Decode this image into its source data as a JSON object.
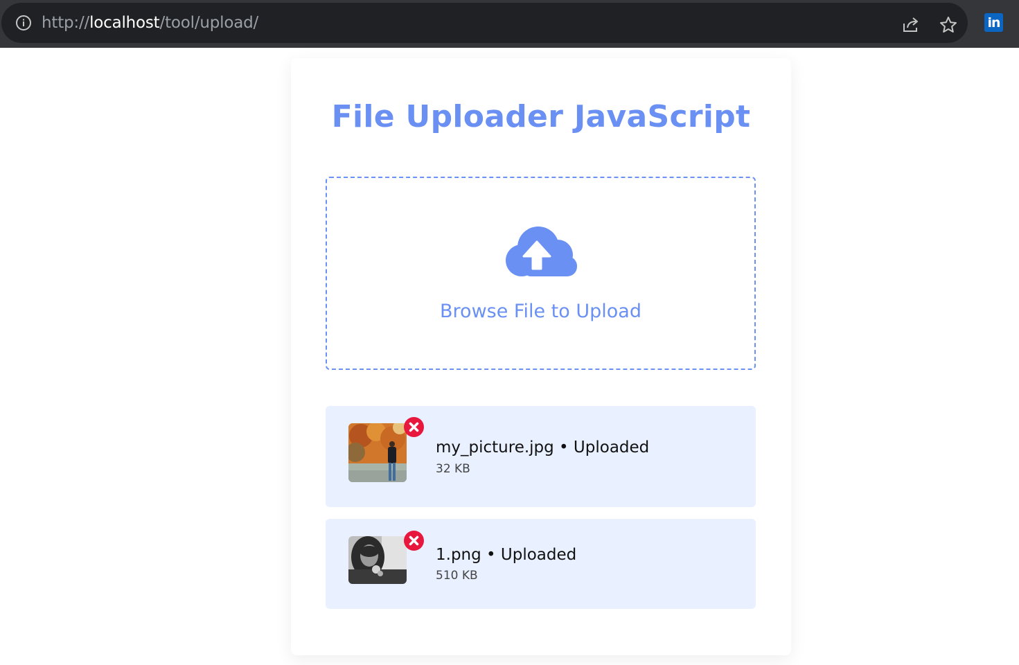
{
  "browser": {
    "url_scheme": "http://",
    "url_host": "localhost",
    "url_path": "/tool/upload/",
    "icons": [
      "info-icon",
      "share-icon",
      "star-icon",
      "linkedin-icon"
    ],
    "extension_label": "in"
  },
  "page": {
    "title": "File Uploader JavaScript",
    "accent_color": "#6990f2"
  },
  "dropzone": {
    "label": "Browse File to Upload",
    "icon": "cloud-upload-icon"
  },
  "files": [
    {
      "name": "my_picture.jpg",
      "status": "Uploaded",
      "display": "my_picture.jpg • Uploaded",
      "size": "32 KB",
      "remove_icon": "remove-icon"
    },
    {
      "name": "1.png",
      "status": "Uploaded",
      "display": "1.png • Uploaded",
      "size": "510 KB",
      "remove_icon": "remove-icon"
    }
  ],
  "colors": {
    "row_background": "#e9f0ff",
    "remove_red": "#e8173e"
  }
}
